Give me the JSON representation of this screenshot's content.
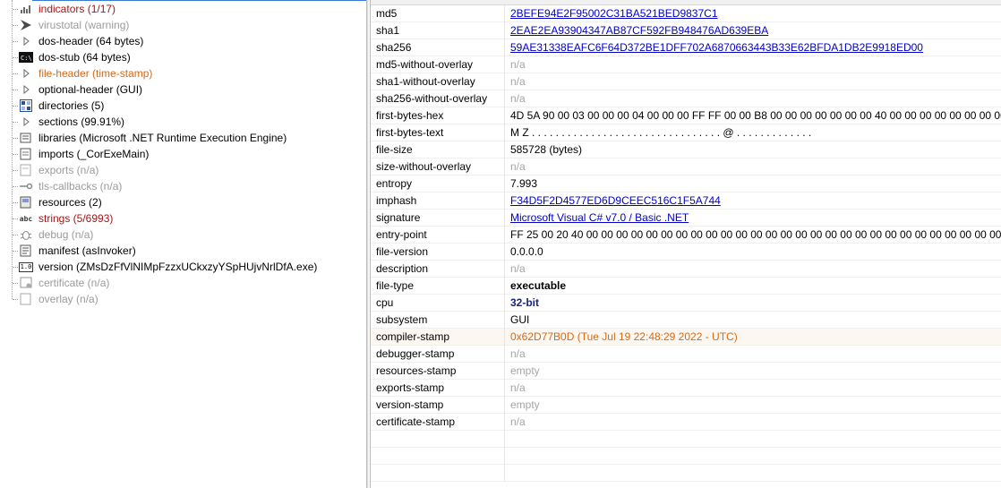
{
  "tree": {
    "items": [
      {
        "label": "indicators (1/17)",
        "icon": "bar-chart-icon",
        "color": "red"
      },
      {
        "label": "virustotal (warning)",
        "icon": "virustotal-icon",
        "color": "gray"
      },
      {
        "label": "dos-header (64 bytes)",
        "icon": "arrow-right-icon",
        "color": "black"
      },
      {
        "label": "dos-stub (64 bytes)",
        "icon": "console-icon",
        "color": "black"
      },
      {
        "label": "file-header (time-stamp)",
        "icon": "arrow-right-icon",
        "color": "orange"
      },
      {
        "label": "optional-header (GUI)",
        "icon": "arrow-right-icon",
        "color": "black"
      },
      {
        "label": "directories (5)",
        "icon": "grid-icon",
        "color": "black"
      },
      {
        "label": "sections (99.91%)",
        "icon": "arrow-right-icon",
        "color": "black"
      },
      {
        "label": "libraries (Microsoft .NET Runtime Execution Engine)",
        "icon": "library-icon",
        "color": "black"
      },
      {
        "label": "imports (_CorExeMain)",
        "icon": "import-icon",
        "color": "black"
      },
      {
        "label": "exports (n/a)",
        "icon": "export-icon",
        "color": "gray"
      },
      {
        "label": "tls-callbacks (n/a)",
        "icon": "key-icon",
        "color": "gray"
      },
      {
        "label": "resources (2)",
        "icon": "resources-icon",
        "color": "black"
      },
      {
        "label": "strings (5/6993)",
        "icon": "abc-icon",
        "color": "red"
      },
      {
        "label": "debug (n/a)",
        "icon": "bug-icon",
        "color": "gray"
      },
      {
        "label": "manifest (asInvoker)",
        "icon": "manifest-icon",
        "color": "black"
      },
      {
        "label": "version (ZMsDzFfVlNIMpFzzxUCkxzyYSpHUjvNrlDfA.exe)",
        "icon": "version-icon",
        "color": "black"
      },
      {
        "label": "certificate (n/a)",
        "icon": "certificate-icon",
        "color": "gray"
      },
      {
        "label": "overlay (n/a)",
        "icon": "overlay-icon",
        "color": "gray"
      }
    ]
  },
  "grid": {
    "rows": [
      {
        "property": "md5",
        "value": "2BEFE94E2F95002C31BA521BED9837C1",
        "style": "link"
      },
      {
        "property": "sha1",
        "value": "2EAE2EA93904347AB87CF592FB948476AD639EBA",
        "style": "link"
      },
      {
        "property": "sha256",
        "value": "59AE31338EAFC6F64D372BE1DFF702A6870663443B33E62BFDA1DB2E9918ED00",
        "style": "link"
      },
      {
        "property": "md5-without-overlay",
        "value": "n/a",
        "style": "na"
      },
      {
        "property": "sha1-without-overlay",
        "value": "n/a",
        "style": "na"
      },
      {
        "property": "sha256-without-overlay",
        "value": "n/a",
        "style": "na"
      },
      {
        "property": "first-bytes-hex",
        "value": "4D 5A 90 00 03 00 00 00 04 00 00 00 FF FF 00 00 B8 00 00 00 00 00 00 00 40 00 00 00 00 00 00 00 00 00",
        "style": "black"
      },
      {
        "property": "first-bytes-text",
        "value": "M Z . . . . . . . . . . . . . . . . . . . . . . . . . . . . . . . . @ . . . . . . . . . . . . .",
        "style": "black"
      },
      {
        "property": "file-size",
        "value": "585728 (bytes)",
        "style": "black"
      },
      {
        "property": "size-without-overlay",
        "value": "n/a",
        "style": "na"
      },
      {
        "property": "entropy",
        "value": "7.993",
        "style": "black"
      },
      {
        "property": "imphash",
        "value": "F34D5F2D4577ED6D9CEEC516C1F5A744",
        "style": "link"
      },
      {
        "property": "signature",
        "value": "Microsoft Visual C# v7.0 / Basic .NET",
        "style": "link"
      },
      {
        "property": "entry-point",
        "value": "FF 25 00 20 40 00 00 00 00 00 00 00 00 00 00 00 00 00 00 00 00 00 00 00 00 00 00 00 00 00 00 00 00 00 00 00 00 00",
        "style": "black"
      },
      {
        "property": "file-version",
        "value": "0.0.0.0",
        "style": "black"
      },
      {
        "property": "description",
        "value": "n/a",
        "style": "na"
      },
      {
        "property": "file-type",
        "value": "executable",
        "style": "bold"
      },
      {
        "property": "cpu",
        "value": "32-bit",
        "style": "boldblue"
      },
      {
        "property": "subsystem",
        "value": "GUI",
        "style": "black"
      },
      {
        "property": "compiler-stamp",
        "value": "0x62D77B0D (Tue Jul 19 22:48:29 2022 - UTC)",
        "style": "orange"
      },
      {
        "property": "debugger-stamp",
        "value": "n/a",
        "style": "na"
      },
      {
        "property": "resources-stamp",
        "value": "empty",
        "style": "na"
      },
      {
        "property": "exports-stamp",
        "value": "n/a",
        "style": "na"
      },
      {
        "property": "version-stamp",
        "value": "empty",
        "style": "na"
      },
      {
        "property": "certificate-stamp",
        "value": "n/a",
        "style": "na"
      },
      {
        "property": "",
        "value": "",
        "style": "black"
      },
      {
        "property": "",
        "value": "",
        "style": "black"
      },
      {
        "property": "",
        "value": "",
        "style": "black"
      }
    ]
  },
  "colors": {
    "link": "#0000c8",
    "orange": "#d26a1b",
    "red": "#a31515",
    "gray": "#9b9b9b",
    "highlight": "#fcf8f1"
  }
}
